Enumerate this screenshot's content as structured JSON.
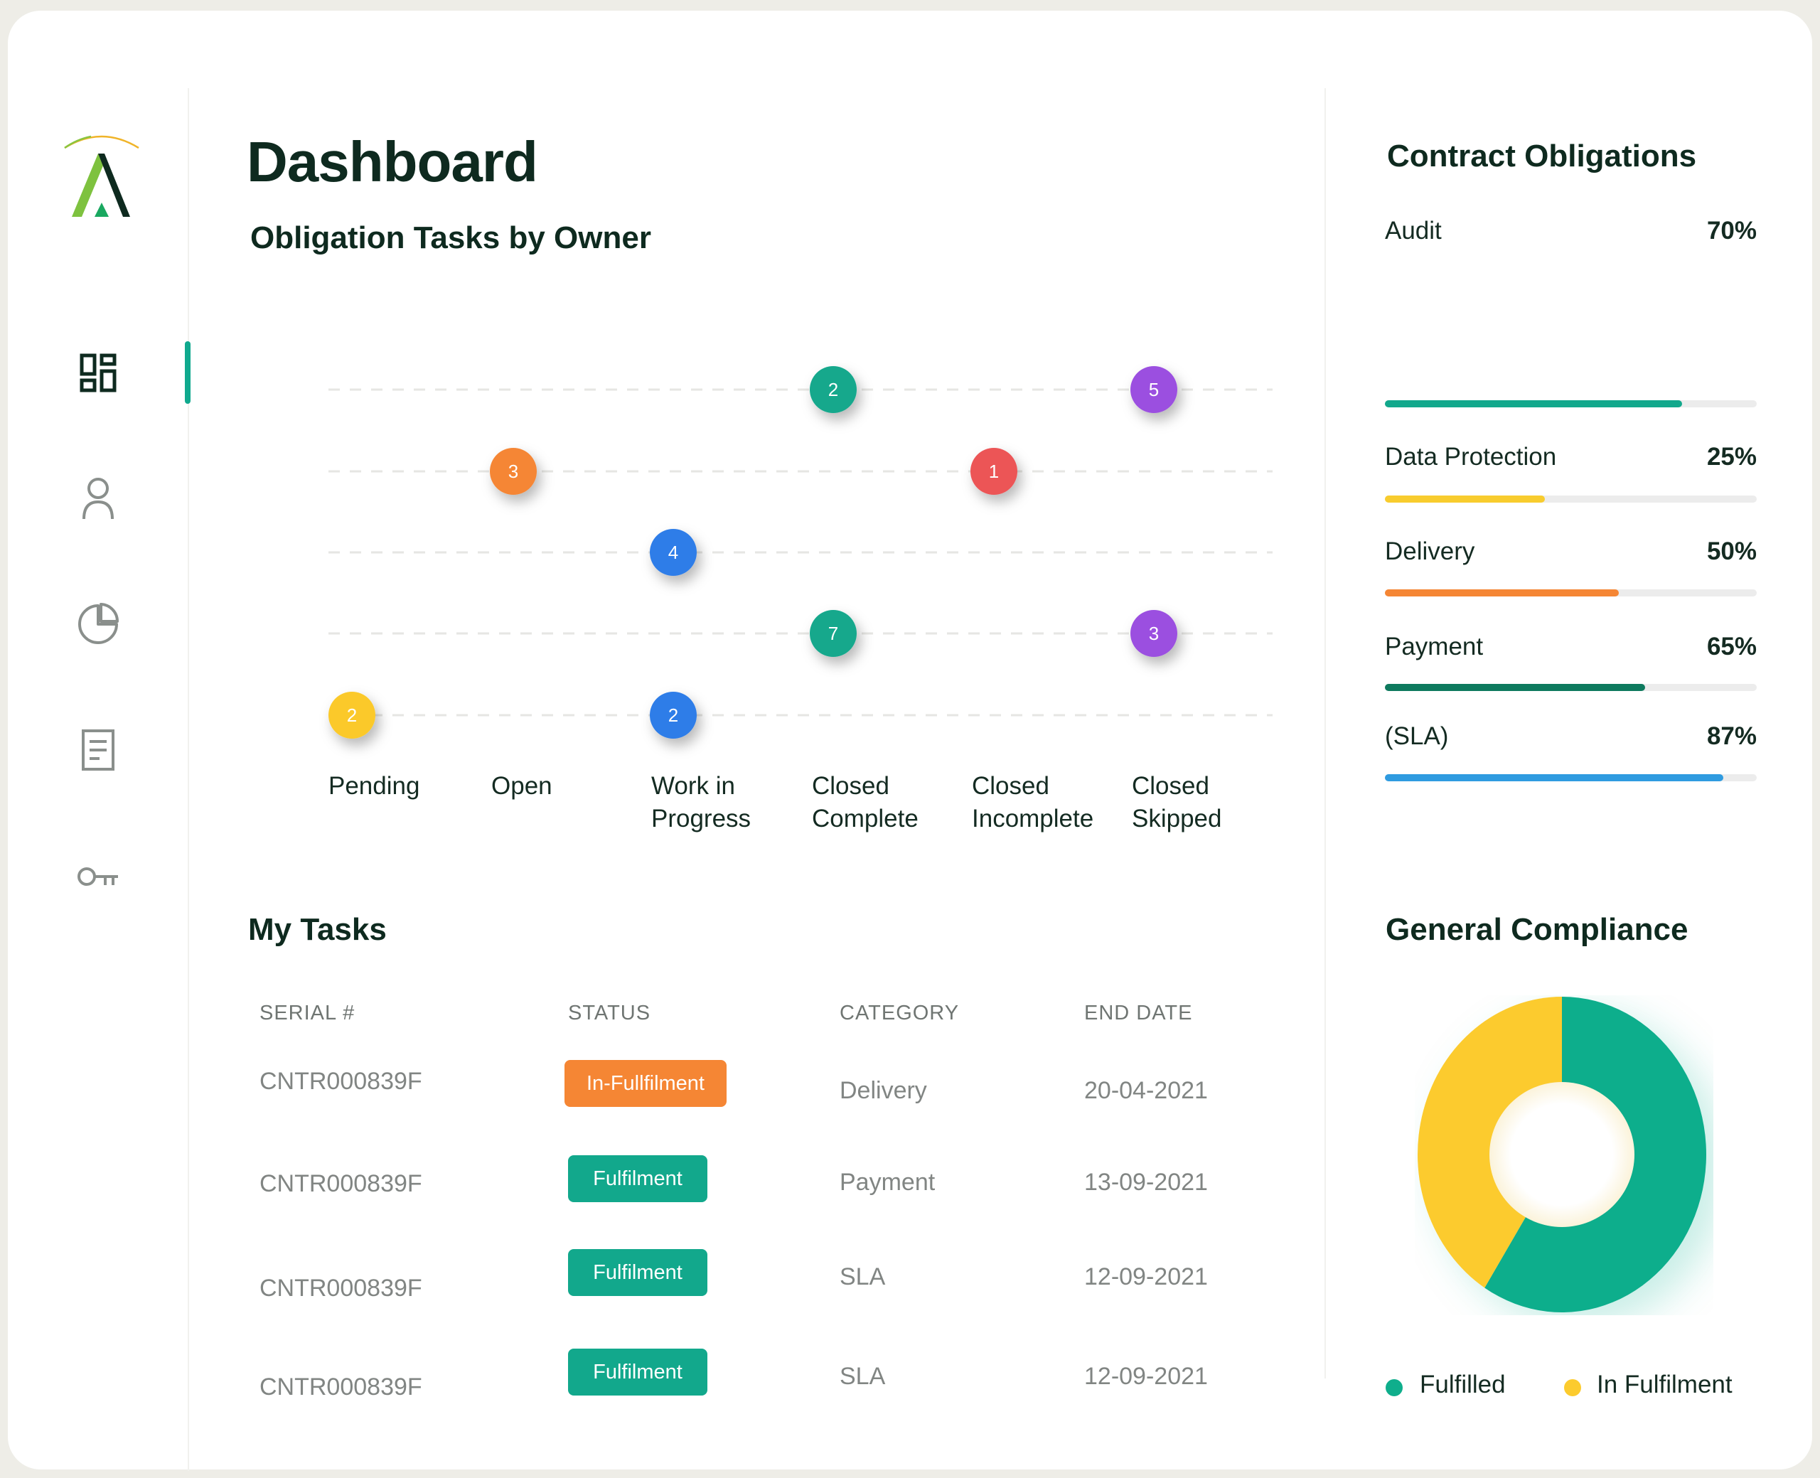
{
  "page": {
    "title": "Dashboard"
  },
  "sidebar": {
    "items": [
      {
        "name": "dashboard",
        "icon": "grid-icon",
        "active": true
      },
      {
        "name": "users",
        "icon": "user-icon",
        "active": false
      },
      {
        "name": "reports",
        "icon": "pie-chart-icon",
        "active": false
      },
      {
        "name": "documents",
        "icon": "document-icon",
        "active": false
      },
      {
        "name": "access",
        "icon": "key-icon",
        "active": false
      }
    ]
  },
  "obligation_chart": {
    "title": "Obligation Tasks by Owner",
    "categories": [
      "Pending",
      "Open",
      "Work in Progress",
      "Closed Complete",
      "Closed Incomplete",
      "Closed Skipped"
    ],
    "category_lines": [
      [
        "Pending"
      ],
      [
        "Open"
      ],
      [
        "Work in",
        "Progress"
      ],
      [
        "Closed",
        "Complete"
      ],
      [
        "Closed",
        "Incomplete"
      ],
      [
        "Closed",
        "Skipped"
      ]
    ],
    "rows": 5
  },
  "chart_data": [
    {
      "type": "scatter",
      "title": "Obligation Tasks by Owner",
      "categories": [
        "Pending",
        "Open",
        "Work in Progress",
        "Closed Complete",
        "Closed Incomplete",
        "Closed Skipped"
      ],
      "points": [
        {
          "category": "Closed Complete",
          "row": 1,
          "value": 2,
          "color": "#12a88c"
        },
        {
          "category": "Closed Skipped",
          "row": 1,
          "value": 5,
          "color": "#9b4fe0"
        },
        {
          "category": "Open",
          "row": 2,
          "value": 3,
          "color": "#f58634"
        },
        {
          "category": "Closed Incomplete",
          "row": 2,
          "value": 1,
          "color": "#ec5457"
        },
        {
          "category": "Work in Progress",
          "row": 3,
          "value": 4,
          "color": "#2f7de8"
        },
        {
          "category": "Closed Complete",
          "row": 4,
          "value": 7,
          "color": "#12a88c"
        },
        {
          "category": "Closed Skipped",
          "row": 4,
          "value": 3,
          "color": "#9b4fe0"
        },
        {
          "category": "Pending",
          "row": 5,
          "value": 2,
          "color": "#fbc92b"
        },
        {
          "category": "Work in Progress",
          "row": 5,
          "value": 2,
          "color": "#2f7de8"
        }
      ]
    },
    {
      "type": "pie",
      "title": "General Compliance",
      "slices": [
        {
          "label": "Fulfilled",
          "value": 59,
          "color": "#0fae8c"
        },
        {
          "label": "In Fulfilment",
          "value": 41,
          "color": "#fccb2e"
        }
      ]
    }
  ],
  "contract_obligations": {
    "title": "Contract Obligations",
    "items": [
      {
        "label": "Audit",
        "value": "70%",
        "percent": 80,
        "color": "#12a88c"
      },
      {
        "label": "Data Protection",
        "value": "25%",
        "percent": 43,
        "color": "#f8cc2e"
      },
      {
        "label": "Delivery",
        "value": "50%",
        "percent": 63,
        "color": "#f58634"
      },
      {
        "label": "Payment",
        "value": "65%",
        "percent": 70,
        "color": "#0e7a5e"
      },
      {
        "label": "(SLA)",
        "value": "87%",
        "percent": 91,
        "color": "#2f9be0"
      }
    ]
  },
  "tasks": {
    "title": "My Tasks",
    "columns": [
      "SERIAL #",
      "STATUS",
      "CATEGORY",
      "END DATE"
    ],
    "rows": [
      {
        "serial": "CNTR000839F",
        "status": "In-Fullfilment",
        "status_color": "#f58634",
        "category": "Delivery",
        "end_date": "20-04-2021"
      },
      {
        "serial": "CNTR000839F",
        "status": "Fulfilment",
        "status_color": "#12a88c",
        "category": "Payment",
        "end_date": "13-09-2021"
      },
      {
        "serial": "CNTR000839F",
        "status": "Fulfilment",
        "status_color": "#12a88c",
        "category": "SLA",
        "end_date": "12-09-2021"
      },
      {
        "serial": "CNTR000839F",
        "status": "Fulfilment",
        "status_color": "#12a88c",
        "category": "SLA",
        "end_date": "12-09-2021"
      }
    ]
  },
  "compliance": {
    "title": "General Compliance",
    "legend": [
      {
        "label": "Fulfilled",
        "color": "#0fae8c"
      },
      {
        "label": "In Fulfilment",
        "color": "#fccb2e"
      }
    ]
  }
}
